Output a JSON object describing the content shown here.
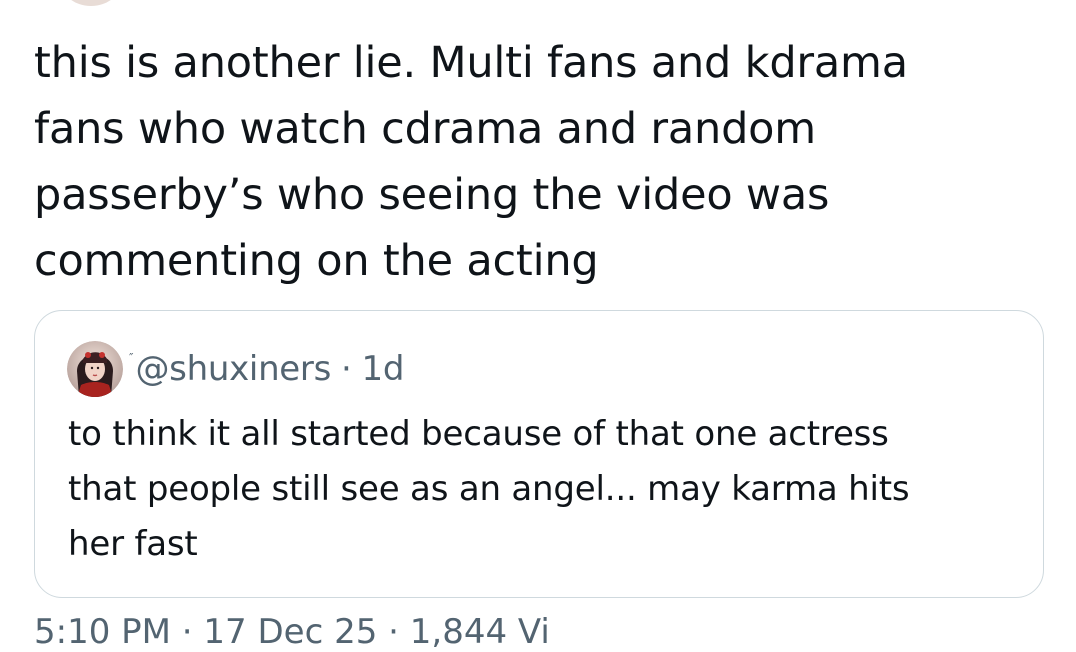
{
  "tweet": {
    "text": "this is another lie. Multi fans and kdrama\nfans who watch cdrama and random\npasserby’s who seeing the video was\ncommenting on the acting"
  },
  "quote": {
    "avatar_icon": "user-avatar-icon",
    "name_mark": "″",
    "handle": "@shuxiners",
    "separator": "·",
    "age": "1d",
    "text": "to think it all started because of that one actress\nthat people still see as an angel... may karma hits\nher fast"
  },
  "meta": {
    "text": "5:10 PM · 17 Dec 25 · 1,844 Vi"
  },
  "colors": {
    "text": "#0f1419",
    "secondary": "#536471",
    "border": "#cfd9de"
  }
}
